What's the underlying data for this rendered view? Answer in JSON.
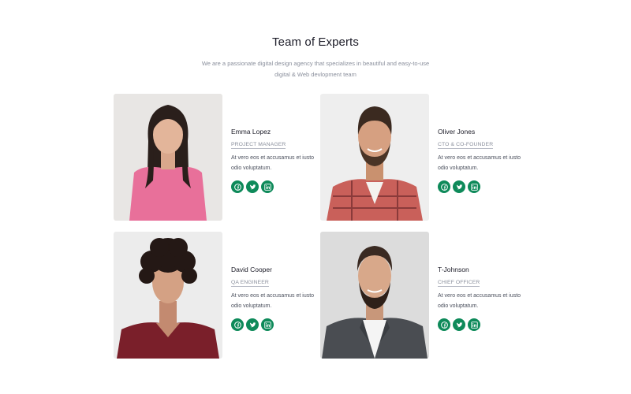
{
  "section": {
    "title": "Team of Experts",
    "subtitle": "We are a passionate digital design agency that specializes in beautiful and easy-to-use digital & Web devlopment team"
  },
  "members": [
    {
      "name": "Emma Lopez",
      "role": "PROJECT MANAGER",
      "description": "At vero eos et accusamus et iusto odio voluptatum."
    },
    {
      "name": "Oliver Jones",
      "role": "CTO & CO-FOUNDER",
      "description": "At vero eos et accusamus et iusto odio voluptatum."
    },
    {
      "name": "David Cooper",
      "role": "QA ENGINEER",
      "description": "At vero eos et accusamus et iusto odio voluptatum."
    },
    {
      "name": "T-Johnson",
      "role": "CHIEF OFFICER",
      "description": "At vero eos et accusamus et iusto odio voluptatum."
    }
  ],
  "social_icons": [
    "facebook-icon",
    "twitter-icon",
    "linkedin-icon"
  ],
  "colors": {
    "accent": "#0e8a5a",
    "title": "#1c1c28",
    "muted": "#8a8f9c"
  }
}
